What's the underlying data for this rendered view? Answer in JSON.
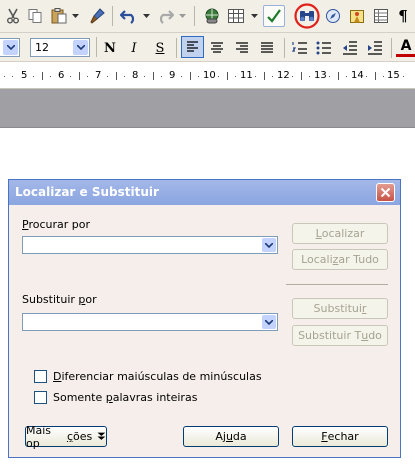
{
  "toolbar_top": {
    "icons": [
      "cut-icon",
      "copy-icon",
      "paste-icon",
      "chevron-down-icon",
      "format-paintbrush-icon",
      "undo-icon",
      "chevron-down-icon",
      "redo-icon",
      "chevron-down-icon",
      "hyperlink-icon",
      "table-icon",
      "chevron-down-icon",
      "show-draw-functions-icon",
      "find-replace-binoculars-icon",
      "navigator-icon",
      "gallery-icon",
      "data-sources-icon",
      "formatting-marks-icon"
    ],
    "formatting_marks_glyph": "¶",
    "highlight_color": "#e0201b"
  },
  "toolbar_format": {
    "font_size": "12",
    "bold": "N",
    "italic": "I",
    "underline": "S",
    "font_color_glyph": "A",
    "font_color_accent": "#c00000"
  },
  "ruler": {
    "numbers": [
      "5",
      "6",
      "7",
      "8",
      "9",
      "10",
      "11",
      "12",
      "13",
      "14",
      "15"
    ]
  },
  "dialog": {
    "title": "Localizar e Substituir",
    "search_label_text": "rocurar por",
    "search_label_key": "P",
    "search_value": "",
    "replace_label_text": "Substituir ",
    "replace_label_key": "p",
    "replace_label_rest": "or",
    "replace_value": "",
    "find_button": {
      "key": "L",
      "rest": "ocalizar"
    },
    "find_all_button": {
      "pre": "Locali",
      "key": "z",
      "rest": "ar Tudo"
    },
    "replace_button": {
      "pre": "Substitui",
      "key": "r",
      "rest": ""
    },
    "replace_all_button": {
      "pre": "Substituir T",
      "key": "u",
      "rest": "do"
    },
    "match_case": {
      "key": "D",
      "rest": "iferenciar maiúsculas de minúsculas",
      "checked": false
    },
    "whole_words": {
      "pre": "Somente ",
      "key": "p",
      "rest": "alavras inteiras",
      "checked": false
    },
    "more_options_button": {
      "pre": "Mais op",
      "key": "ç",
      "rest": "ões"
    },
    "help_button": {
      "pre": "Aj",
      "key": "u",
      "rest": "da"
    },
    "close_button": {
      "key": "F",
      "rest": "echar"
    }
  }
}
